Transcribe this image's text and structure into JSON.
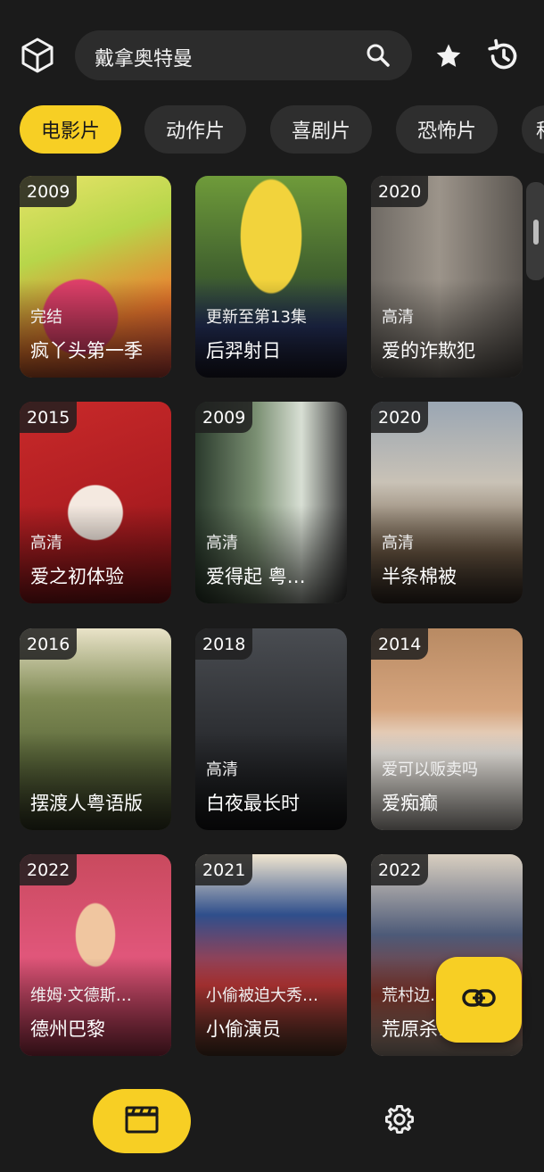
{
  "header": {
    "search_value": "戴拿奥特曼",
    "icons": [
      "cube-icon",
      "search-icon",
      "star-icon",
      "history-icon"
    ]
  },
  "tabs": [
    {
      "label": "电影片",
      "active": true
    },
    {
      "label": "动作片",
      "active": false
    },
    {
      "label": "喜剧片",
      "active": false
    },
    {
      "label": "恐怖片",
      "active": false
    },
    {
      "label": "科",
      "active": false
    }
  ],
  "movies": [
    {
      "year": "2009",
      "status": "完结",
      "title": "疯丫头第一季"
    },
    {
      "year": "",
      "status": "更新至第13集",
      "title": "后羿射日"
    },
    {
      "year": "2020",
      "status": "高清",
      "title": "爱的诈欺犯"
    },
    {
      "year": "2015",
      "status": "高清",
      "title": "爱之初体验"
    },
    {
      "year": "2009",
      "status": "高清",
      "title": "爱得起 粤…"
    },
    {
      "year": "2020",
      "status": "高清",
      "title": "半条棉被"
    },
    {
      "year": "2016",
      "status": "",
      "title": "摆渡人粤语版"
    },
    {
      "year": "2018",
      "status": "高清",
      "title": "白夜最长时"
    },
    {
      "year": "2014",
      "status": "爱可以贩卖吗",
      "title": "爱痴癫"
    },
    {
      "year": "2022",
      "status": "维姆·文德斯…",
      "title": "德州巴黎"
    },
    {
      "year": "2021",
      "status": "小偷被迫大秀…",
      "title": "小偷演员"
    },
    {
      "year": "2022",
      "status": "荒村边…",
      "title": "荒原杀…"
    }
  ],
  "nav": {
    "items": [
      "movie-clapper-icon",
      "settings-gear-icon"
    ]
  },
  "colors": {
    "accent": "#f7cf24",
    "background": "#1b1b1b",
    "chip": "#2e2e2e"
  }
}
